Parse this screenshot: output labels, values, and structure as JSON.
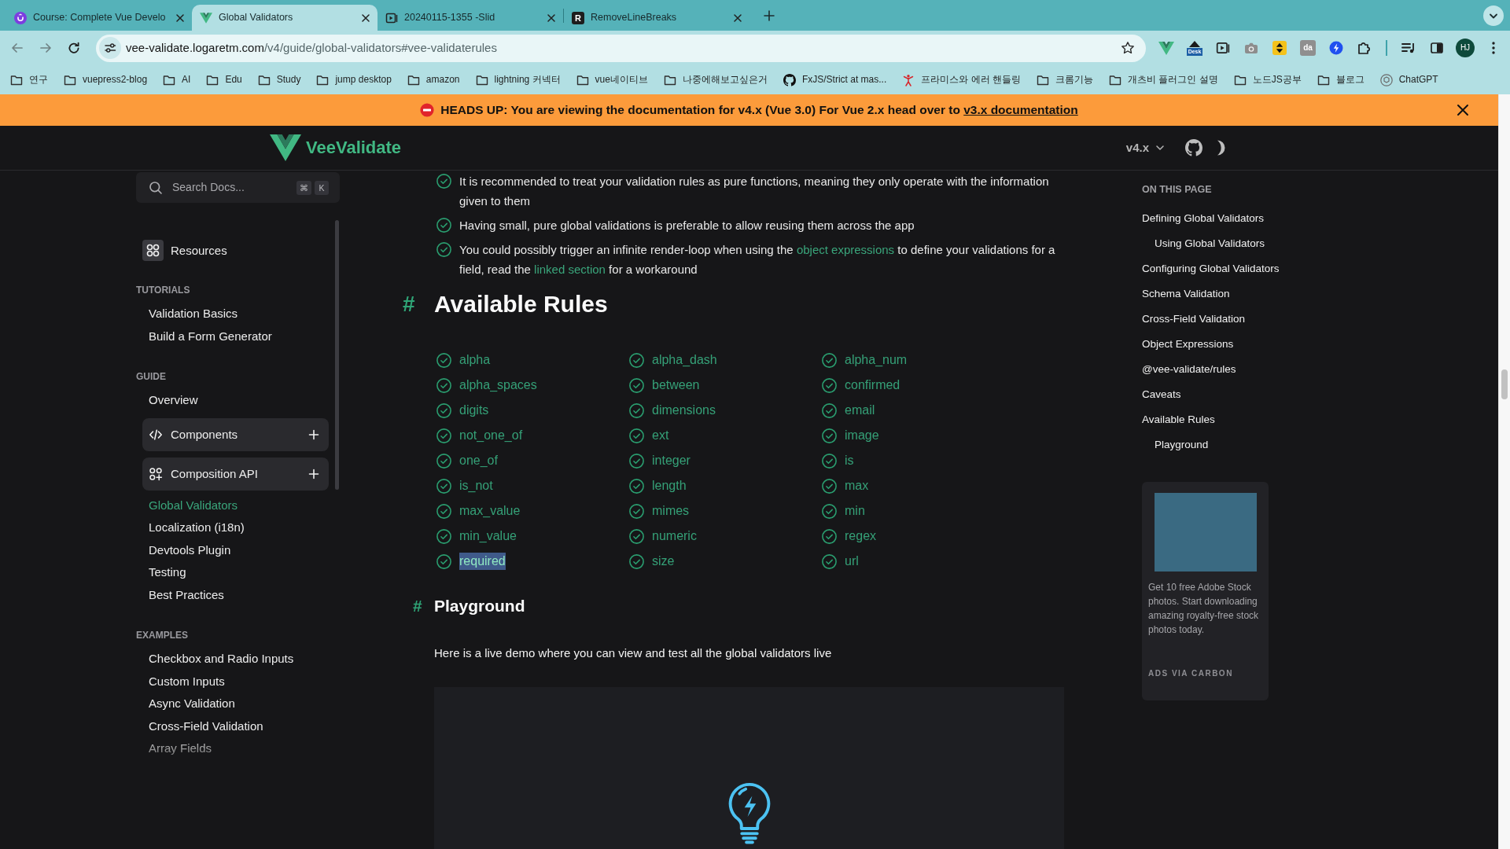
{
  "browser": {
    "tabs": [
      {
        "kind": "course",
        "title": "Course: Complete Vue Develo",
        "selected": false
      },
      {
        "kind": "vee",
        "title": "Global Validators",
        "selected": true
      },
      {
        "kind": "slides",
        "title": "20240115-1355 -Slid",
        "selected": false
      },
      {
        "kind": "letter",
        "favicon_text": "R",
        "title": "RemoveLineBreaks",
        "selected": false
      }
    ],
    "url": {
      "host": "vee-validate.logaretm.com",
      "path": "/v4/guide/global-validators#vee-validaterules"
    },
    "extensions": [
      {
        "kind": "vee"
      },
      {
        "kind": "desk",
        "label": "Desk"
      },
      {
        "kind": "media"
      },
      {
        "kind": "camera"
      },
      {
        "kind": "updown"
      },
      {
        "kind": "da",
        "label": "da"
      },
      {
        "kind": "bolt"
      },
      {
        "kind": "puzzle"
      }
    ],
    "profile": "HJ",
    "bookmarks": [
      {
        "kind": "folder",
        "label": "연구"
      },
      {
        "kind": "folder",
        "label": "vuepress2-blog"
      },
      {
        "kind": "folder",
        "label": "AI"
      },
      {
        "kind": "folder",
        "label": "Edu"
      },
      {
        "kind": "folder",
        "label": "Study"
      },
      {
        "kind": "folder",
        "label": "jump desktop"
      },
      {
        "kind": "folder",
        "label": "amazon"
      },
      {
        "kind": "folder",
        "label": "lightning 커넥터"
      },
      {
        "kind": "folder",
        "label": "vue네이티브"
      },
      {
        "kind": "folder",
        "label": "나중에해보고싶은거"
      },
      {
        "kind": "github",
        "label": "FxJS/Strict at mas..."
      },
      {
        "kind": "figure",
        "label": "프라미스와 에러 핸들링"
      },
      {
        "kind": "folder",
        "label": "크롬기능"
      },
      {
        "kind": "folder",
        "label": "개츠비 플러그인 설명"
      },
      {
        "kind": "folder",
        "label": "노드JS공부"
      },
      {
        "kind": "folder",
        "label": "블로그"
      },
      {
        "kind": "chatgpt",
        "label": "ChatGPT"
      }
    ]
  },
  "banner": {
    "text": "HEADS UP: You are viewing the documentation for v4.x (Vue 3.0) For Vue 2.x head over to",
    "link": "v3.x documentation"
  },
  "header": {
    "brand": "VeeValidate",
    "version": "v4.x"
  },
  "sidebar": {
    "search": {
      "label": "Search Docs...",
      "keys": [
        "⌘",
        "K"
      ]
    },
    "resources": "Resources",
    "sections": [
      {
        "title": "TUTORIALS",
        "items": [
          {
            "kind": "link",
            "label": "Validation Basics",
            "selected": false
          },
          {
            "kind": "link",
            "label": "Build a Form Generator",
            "selected": false
          }
        ]
      },
      {
        "title": "GUIDE",
        "items": [
          {
            "kind": "link",
            "label": "Overview",
            "selected": false
          },
          {
            "kind": "group",
            "label": "Components",
            "expanded": false,
            "selected": false
          },
          {
            "kind": "group",
            "label": "Composition API",
            "expanded": false,
            "selected": false
          },
          {
            "kind": "link",
            "label": "Global Validators",
            "selected": true
          },
          {
            "kind": "link",
            "label": "Localization (i18n)",
            "selected": false
          },
          {
            "kind": "link",
            "label": "Devtools Plugin",
            "selected": false
          },
          {
            "kind": "link",
            "label": "Testing",
            "selected": false
          },
          {
            "kind": "link",
            "label": "Best Practices",
            "selected": false
          }
        ]
      },
      {
        "title": "EXAMPLES",
        "items": [
          {
            "kind": "link",
            "label": "Checkbox and Radio Inputs",
            "selected": false
          },
          {
            "kind": "link",
            "label": "Custom Inputs",
            "selected": false
          },
          {
            "kind": "link",
            "label": "Async Validation",
            "selected": false
          },
          {
            "kind": "link",
            "label": "Cross-Field Validation",
            "selected": false
          },
          {
            "kind": "link",
            "label": "Array Fields",
            "selected": false
          }
        ]
      }
    ]
  },
  "content": {
    "bullets": [
      {
        "parts": [
          {
            "kind": "text",
            "text": "It is recommended to treat your validation rules as pure functions, meaning they only operate with the information given to them"
          }
        ]
      },
      {
        "parts": [
          {
            "kind": "text",
            "text": "Having small, pure global validations is preferable to allow reusing them across the app"
          }
        ]
      },
      {
        "parts": [
          {
            "kind": "text",
            "text": "You could possibly trigger an infinite render-loop when using the "
          },
          {
            "kind": "link",
            "text": "object expressions"
          },
          {
            "kind": "text",
            "text": " to define your validations for a field, read the "
          },
          {
            "kind": "link",
            "text": "linked section"
          },
          {
            "kind": "text",
            "text": " for a workaround"
          }
        ]
      }
    ],
    "sections": [
      {
        "kind": "rules",
        "anchor": "#",
        "title": "Available Rules",
        "rules": [
          {
            "name": "alpha",
            "highlighted": false
          },
          {
            "name": "alpha_dash",
            "highlighted": false
          },
          {
            "name": "alpha_num",
            "highlighted": false
          },
          {
            "name": "alpha_spaces",
            "highlighted": false
          },
          {
            "name": "between",
            "highlighted": false
          },
          {
            "name": "confirmed",
            "highlighted": false
          },
          {
            "name": "digits",
            "highlighted": false
          },
          {
            "name": "dimensions",
            "highlighted": false
          },
          {
            "name": "email",
            "highlighted": false
          },
          {
            "name": "not_one_of",
            "highlighted": false
          },
          {
            "name": "ext",
            "highlighted": false
          },
          {
            "name": "image",
            "highlighted": false
          },
          {
            "name": "one_of",
            "highlighted": false
          },
          {
            "name": "integer",
            "highlighted": false
          },
          {
            "name": "is",
            "highlighted": false
          },
          {
            "name": "is_not",
            "highlighted": false
          },
          {
            "name": "length",
            "highlighted": false
          },
          {
            "name": "max",
            "highlighted": false
          },
          {
            "name": "max_value",
            "highlighted": false
          },
          {
            "name": "mimes",
            "highlighted": false
          },
          {
            "name": "min",
            "highlighted": false
          },
          {
            "name": "min_value",
            "highlighted": false
          },
          {
            "name": "numeric",
            "highlighted": false
          },
          {
            "name": "regex",
            "highlighted": false
          },
          {
            "name": "required",
            "highlighted": true
          },
          {
            "name": "size",
            "highlighted": false
          },
          {
            "name": "url",
            "highlighted": false
          }
        ]
      },
      {
        "kind": "demo",
        "anchor": "#",
        "title": "Playground",
        "intro": "Here is a live demo where you can view and test all the global validators live"
      }
    ]
  },
  "toc": {
    "title": "ON THIS PAGE",
    "items": [
      {
        "label": "Defining Global Validators",
        "children": [
          {
            "label": "Using Global Validators"
          }
        ]
      },
      {
        "label": "Configuring Global Validators"
      },
      {
        "label": "Schema Validation"
      },
      {
        "label": "Cross-Field Validation"
      },
      {
        "label": "Object Expressions"
      },
      {
        "label": "@vee-validate/rules"
      },
      {
        "label": "Caveats"
      },
      {
        "label": "Available Rules",
        "children": [
          {
            "label": "Playground"
          }
        ]
      }
    ]
  },
  "ad": {
    "text": "Get 10 free Adobe Stock photos. Start downloading amazing royalty-free stock photos today.",
    "footer": "ADS VIA CARBON"
  }
}
